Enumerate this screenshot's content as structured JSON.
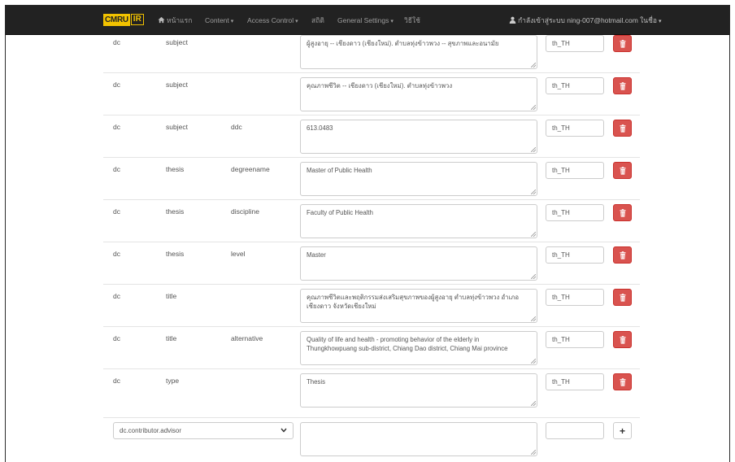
{
  "navbar": {
    "brand_left": "CMRU",
    "brand_right": "IR",
    "home_label": "หน้าแรก",
    "content_label": "Content",
    "access_control_label": "Access Control",
    "stats_label": "สถิติ",
    "general_settings_label": "General Settings",
    "workflow_label": "วิธีใช้",
    "user_label": "กำลังเข้าสู่ระบบ ning-007@hotmail.com ในชื่อ"
  },
  "metadata_rows": [
    {
      "schema": "dc",
      "element": "subject",
      "qualifier": "",
      "value": "ผู้สูงอายุ -- เชียงดาว (เชียงใหม่). ตำบลทุ่งข้าวพวง -- สุขภาพและอนามัย",
      "lang": "th_TH"
    },
    {
      "schema": "dc",
      "element": "subject",
      "qualifier": "",
      "value": "คุณภาพชีวิต -- เชียงดาว (เชียงใหม่). ตำบลทุ่งข้าวพวง",
      "lang": "th_TH"
    },
    {
      "schema": "dc",
      "element": "subject",
      "qualifier": "ddc",
      "value": "613.0483",
      "lang": "th_TH"
    },
    {
      "schema": "dc",
      "element": "thesis",
      "qualifier": "degreename",
      "value": "Master of Public Health",
      "lang": "th_TH"
    },
    {
      "schema": "dc",
      "element": "thesis",
      "qualifier": "discipline",
      "value": "Faculty of Public Health",
      "lang": "th_TH"
    },
    {
      "schema": "dc",
      "element": "thesis",
      "qualifier": "level",
      "value": "Master",
      "lang": "th_TH"
    },
    {
      "schema": "dc",
      "element": "title",
      "qualifier": "",
      "value": "คุณภาพชีวิตและพฤติกรรมส่งเสริมสุขภาพของผู้สูงอายุ ตำบลทุ่งข้าวพวง อำเภอเชียงดาว จังหวัดเชียงใหม่",
      "lang": "th_TH"
    },
    {
      "schema": "dc",
      "element": "title",
      "qualifier": "alternative",
      "value": "Quality of life and health - promoting behavior of the elderly in Thungkhowpuang sub-district, Chiang Dao district, Chiang Mai province",
      "lang": "th_TH"
    },
    {
      "schema": "dc",
      "element": "type",
      "qualifier": "",
      "value": "Thesis",
      "lang": "th_TH"
    }
  ],
  "add_row": {
    "field_select_value": "dc.contributor.advisor",
    "value": "",
    "lang": ""
  },
  "colors": {
    "navbar_bg": "#222222",
    "brand_yellow": "#f2c200",
    "danger": "#d9534f"
  }
}
